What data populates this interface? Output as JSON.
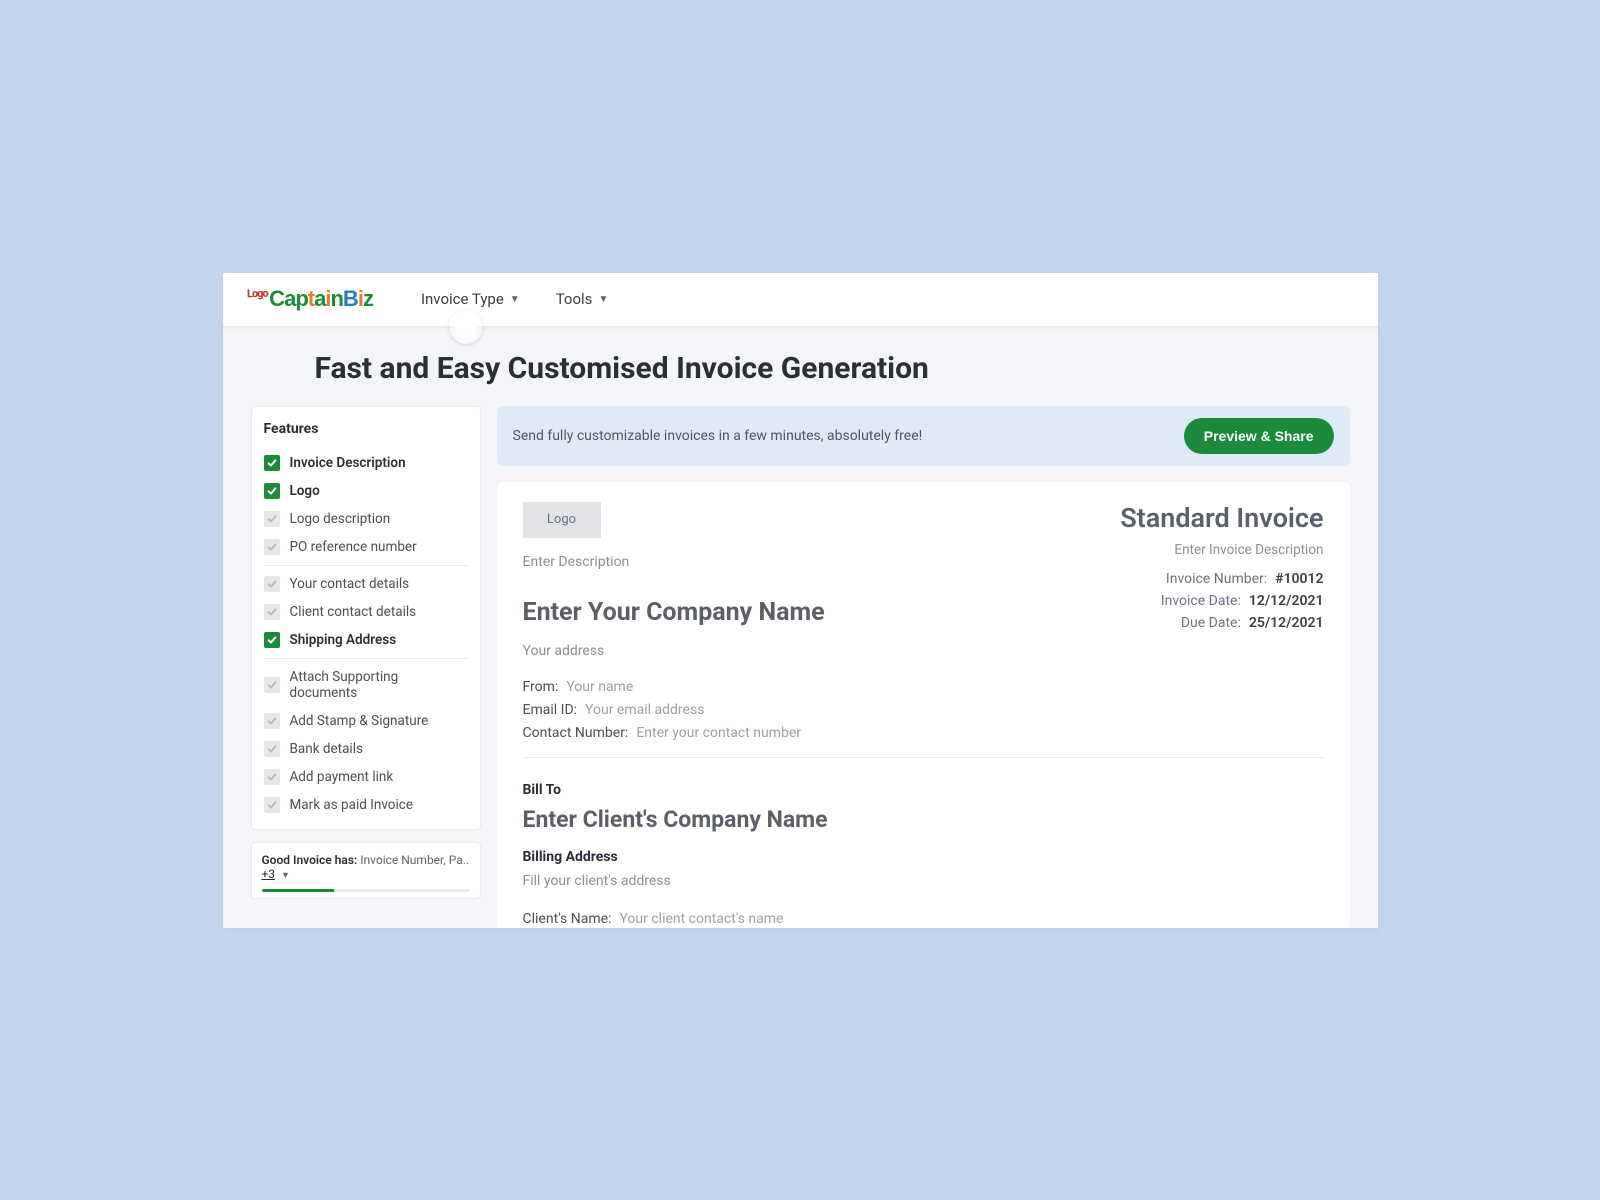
{
  "brand": {
    "prefix": "Logo",
    "name": "CaptainBiz"
  },
  "nav": {
    "invoice_type": "Invoice Type",
    "tools": "Tools"
  },
  "page_title": "Fast and Easy Customised Invoice Generation",
  "sidebar": {
    "features_title": "Features",
    "groups": [
      [
        {
          "label": "Invoice Description",
          "checked": true
        },
        {
          "label": "Logo",
          "checked": true
        },
        {
          "label": "Logo description",
          "checked": false
        },
        {
          "label": "PO reference number",
          "checked": false
        }
      ],
      [
        {
          "label": "Your contact details",
          "checked": false
        },
        {
          "label": "Client contact details",
          "checked": false
        },
        {
          "label": "Shipping Address",
          "checked": true
        }
      ],
      [
        {
          "label": "Attach Supporting documents",
          "checked": false
        },
        {
          "label": "Add Stamp & Signature",
          "checked": false
        },
        {
          "label": "Bank details",
          "checked": false
        },
        {
          "label": "Add payment link",
          "checked": false
        },
        {
          "label": "Mark as paid Invoice",
          "checked": false
        }
      ]
    ],
    "tip": {
      "label": "Good Invoice has:",
      "text": "Invoice Number, Pa..",
      "more": "+3"
    }
  },
  "banner": {
    "text": "Send fully customizable invoices in a few minutes, absolutely free!",
    "button": "Preview & Share"
  },
  "invoice": {
    "logo_label": "Logo",
    "description_placeholder": "Enter Description",
    "company_name_placeholder": "Enter Your Company Name",
    "address_placeholder": "Your address",
    "title": "Standard Invoice",
    "desc_placeholder": "Enter Invoice Description",
    "meta": {
      "number_label": "Invoice Number:",
      "number_value": "#10012",
      "date_label": "Invoice Date:",
      "date_value": "12/12/2021",
      "due_label": "Due Date:",
      "due_value": "25/12/2021"
    },
    "from": {
      "from_label": "From:",
      "from_placeholder": "Your name",
      "email_label": "Email ID:",
      "email_placeholder": "Your email address",
      "contact_label": "Contact Number:",
      "contact_placeholder": "Enter your contact number"
    },
    "billto": {
      "title": "Bill To",
      "client_name_placeholder": "Enter Client's Company Name",
      "billing_address_title": "Billing Address",
      "billing_address_placeholder": "Fill your client's address",
      "client_name_label": "Client's Name:",
      "client_name_value_placeholder": "Your client contact's name"
    }
  }
}
